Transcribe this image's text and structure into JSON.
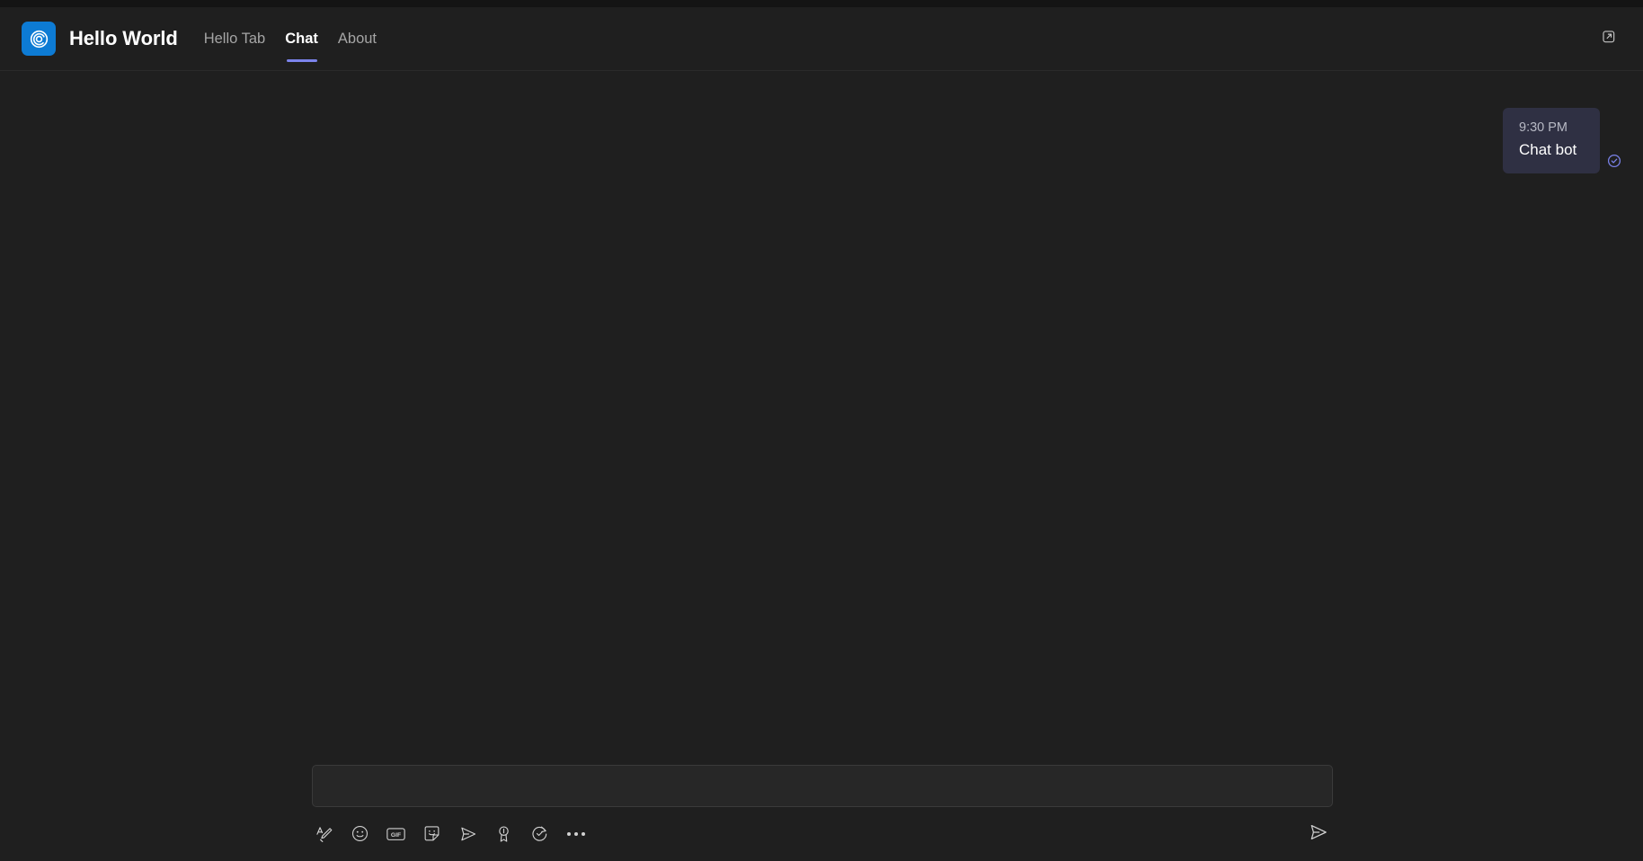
{
  "window": {
    "background": "#1f1f1f",
    "top_strip_color": "#141414"
  },
  "header": {
    "logo": {
      "icon": "swirl-circle-icon",
      "background": "#0d7bd4",
      "glyph_color": "#ffffff"
    },
    "app_title": "Hello World",
    "tabs": [
      {
        "label": "Hello Tab",
        "active": false
      },
      {
        "label": "Chat",
        "active": true
      },
      {
        "label": "About",
        "active": false
      }
    ],
    "active_tab_underline_color": "#7b83eb",
    "popout_button": {
      "icon": "open-in-new-window-icon",
      "label": "Open in new window"
    }
  },
  "chat": {
    "messages": [
      {
        "time": "9:30 PM",
        "text": "Chat bot",
        "outgoing": true,
        "bubble_color": "#2f3043",
        "status_icon": "checkmark-circle-icon",
        "status_color": "#7b83eb"
      }
    ]
  },
  "composer": {
    "input": {
      "value": "",
      "placeholder": ""
    },
    "tools": [
      {
        "name": "format-icon",
        "label": "Format"
      },
      {
        "name": "emoji-icon",
        "label": "Emoji"
      },
      {
        "name": "gif-icon",
        "label": "GIF",
        "text": "GIF"
      },
      {
        "name": "sticker-icon",
        "label": "Sticker"
      },
      {
        "name": "schedule-send-icon",
        "label": "Schedule send"
      },
      {
        "name": "praise-icon",
        "label": "Praise"
      },
      {
        "name": "loop-components-icon",
        "label": "Loop components"
      },
      {
        "name": "more-options-icon",
        "label": "More options"
      }
    ],
    "send_button": {
      "icon": "send-icon",
      "label": "Send"
    }
  }
}
